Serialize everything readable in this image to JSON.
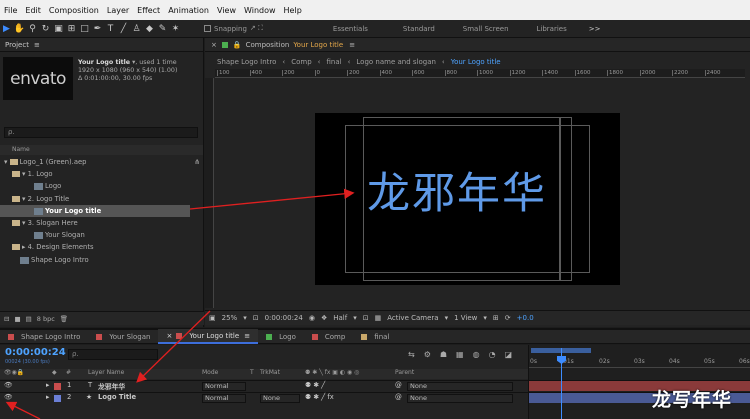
{
  "menu": [
    "File",
    "Edit",
    "Composition",
    "Layer",
    "Effect",
    "Animation",
    "View",
    "Window",
    "Help"
  ],
  "toolbar": {
    "snapping_label": "Snapping",
    "workspaces": [
      "Essentials",
      "Standard",
      "Small Screen",
      "Libraries"
    ],
    "more_glyph": ">>"
  },
  "project": {
    "title": "Project",
    "thumb_logo": "envato",
    "item_name": "Your Logo title",
    "item_used": ", used 1 time",
    "info_size": "1920 x 1080  (960 x 540) (1.00)",
    "info_duration": "Δ 0:01:00:00, 30.00 fps",
    "search_placeholder": "ρ.",
    "col_name": "Name",
    "tree": [
      {
        "label": "Logo_1 (Green).aep",
        "kind": "aep"
      },
      {
        "label": "▾ 1. Logo",
        "kind": "folder"
      },
      {
        "label": "Logo",
        "kind": "comp"
      },
      {
        "label": "▾ 2. Logo Title",
        "kind": "folder"
      },
      {
        "label": "Your Logo title",
        "kind": "comp"
      },
      {
        "label": "▾ 3. Slogan Here",
        "kind": "folder"
      },
      {
        "label": "Your Slogan",
        "kind": "comp"
      },
      {
        "label": "▸ 4. Design Elements",
        "kind": "folder"
      },
      {
        "label": "Shape Logo Intro",
        "kind": "comp"
      }
    ],
    "footer_bpc": "8 bpc"
  },
  "comp": {
    "tab_label": "Composition",
    "tab_name": "Your Logo title",
    "breadcrumbs": [
      "Shape Logo Intro",
      "Comp",
      "final",
      "Logo name and slogan",
      "Your Logo title"
    ],
    "ruler_ticks": [
      "100",
      "400",
      "200",
      "0",
      "200",
      "400",
      "600",
      "800",
      "1000",
      "1200",
      "1400",
      "1600",
      "1800",
      "2000",
      "2200",
      "2400"
    ],
    "canvas_text": "龙邪年华",
    "zoom": "25%",
    "time": "0:00:00:24",
    "resolution": "Half",
    "camera": "Active Camera",
    "view": "1 View",
    "exposure": "+0.0"
  },
  "timeline": {
    "tabs": [
      {
        "label": "Shape Logo Intro",
        "color": "#c94d4d"
      },
      {
        "label": "Your Slogan",
        "color": "#c94d4d"
      },
      {
        "label": "Your Logo title",
        "color": "#c94d4d",
        "active": true
      },
      {
        "label": "Logo",
        "color": "#4caf50"
      },
      {
        "label": "Comp",
        "color": "#c94d4d"
      },
      {
        "label": "final",
        "color": "#c9a86a"
      }
    ],
    "timecode": "0:00:00:24",
    "fps_note": "00024 (30.00 fps)",
    "search_placeholder": "ρ.",
    "cols": {
      "num": "#",
      "name": "Layer Name",
      "mode": "Mode",
      "t": "T",
      "trkmat": "TrkMat",
      "parent": "Parent"
    },
    "layers": [
      {
        "num": "1",
        "type": "T",
        "name": "龙邪年华",
        "mode": "Normal",
        "trkmat": "",
        "parent": "None",
        "color": "#c94d4d"
      },
      {
        "num": "2",
        "type": "★",
        "name": "Logo Title",
        "mode": "Normal",
        "trkmat": "None",
        "parent": "None",
        "color": "#6b7fd6"
      }
    ],
    "ruler": [
      "0s",
      "01s",
      "02s",
      "03s",
      "04s",
      "05s",
      "06s"
    ]
  },
  "watermark": "龙写年华"
}
